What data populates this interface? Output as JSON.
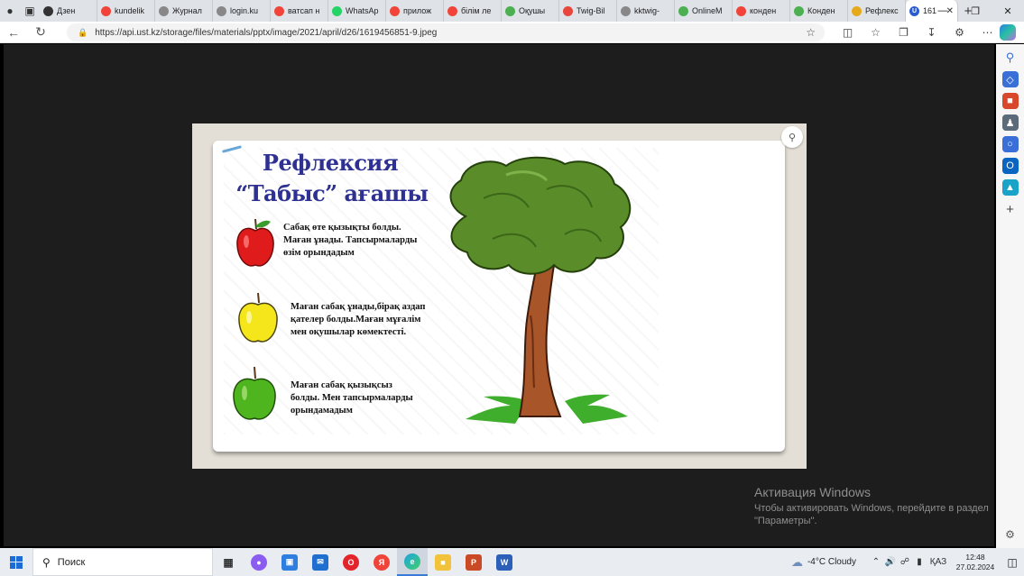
{
  "browser": {
    "tabs": [
      {
        "label": "Дзен",
        "icon": "dzen-icon",
        "color": "#333333"
      },
      {
        "label": "kundelik",
        "icon": "yandex-icon",
        "color": "#f0443a"
      },
      {
        "label": "Журнал",
        "icon": "journal-icon",
        "color": "#888888"
      },
      {
        "label": "login.ku",
        "icon": "page-icon",
        "color": "#888888"
      },
      {
        "label": "ватсап н",
        "icon": "yandex-icon",
        "color": "#f0443a"
      },
      {
        "label": "WhatsAp",
        "icon": "whatsapp-icon",
        "color": "#25d366"
      },
      {
        "label": "прилож",
        "icon": "yandex-icon",
        "color": "#f0443a"
      },
      {
        "label": "білім ле",
        "icon": "yandex-icon",
        "color": "#f0443a"
      },
      {
        "label": "Оқушы",
        "icon": "onlinemektep-icon",
        "color": "#4caf50"
      },
      {
        "label": "Twig-Bil",
        "icon": "twig-icon",
        "color": "#e8453c"
      },
      {
        "label": "kktwig-",
        "icon": "page-icon",
        "color": "#888888"
      },
      {
        "label": "OnlineM",
        "icon": "onlinemektep-icon",
        "color": "#4caf50"
      },
      {
        "label": "конден",
        "icon": "yandex-icon",
        "color": "#f0443a"
      },
      {
        "label": "Конден",
        "icon": "onlinemektep-icon",
        "color": "#4caf50"
      },
      {
        "label": "Рефлекс",
        "icon": "image-icon",
        "color": "#e6a91a"
      }
    ],
    "active_tab": {
      "label": "161",
      "icon": "ust-icon",
      "color": "#2b5ccf"
    },
    "url": "https://api.ust.kz/storage/files/materials/pptx/image/2021/april/d26/1619456851-9.jpeg",
    "url_host": "api.ust.kz"
  },
  "slide": {
    "title_line1": "Рефлексия",
    "title_line2": "“Табыс” ағашы",
    "items": [
      {
        "apple": "red",
        "color": "#e01b1b",
        "text": "Сабақ өте қызықты болды.\nМаған ұнады. Тапсырмаларды\nөзім орындадым"
      },
      {
        "apple": "yellow",
        "color": "#f5e61b",
        "text": "Маған сабақ ұнады,бірақ  аздап\nқателер болды.Маған мұғалім\nмен оқушылар көмектесті."
      },
      {
        "apple": "green",
        "color": "#4fb51f",
        "text": "Маған сабақ қызықсыз\nболды. Мен тапсырмаларды\nорындамадым"
      }
    ]
  },
  "activation": {
    "title": "Активация Windows",
    "subtitle": "Чтобы активировать Windows, перейдите в раздел \"Параметры\"."
  },
  "taskbar": {
    "search_placeholder": "Поиск",
    "weather": "-4°C  Cloudy",
    "lang": "ҚАЗ",
    "time": "12:48",
    "date": "27.02.2024"
  }
}
